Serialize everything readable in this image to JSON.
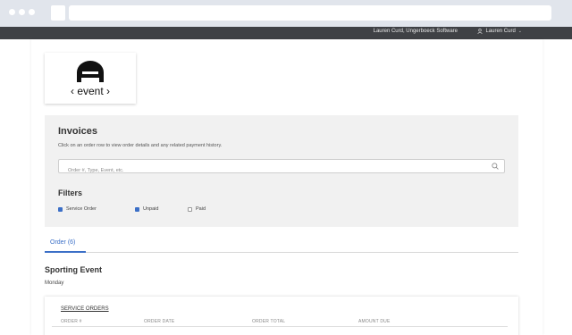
{
  "topnav": {
    "org": "Lauren Curd, Ungerboeck Software",
    "user": "Lauren Curd",
    "user_icon": "user-icon",
    "caret": "⌄"
  },
  "logo": {
    "text": "‹ event ›"
  },
  "invoices": {
    "title": "Invoices",
    "subtitle": "Click on an order row to view order details and any related payment history.",
    "search_placeholder": "Order #, Type, Event, etc.",
    "search_icon": "search-icon"
  },
  "filters": {
    "title": "Filters",
    "items": [
      {
        "label": "Service Order",
        "checked": true
      },
      {
        "label": "Unpaid",
        "checked": true
      },
      {
        "label": "Paid",
        "checked": false
      }
    ]
  },
  "tabs": [
    {
      "label": "Order (6)",
      "active": true
    }
  ],
  "event": {
    "title": "Sporting Event",
    "day": "Monday"
  },
  "orders": {
    "title": "SERVICE ORDERS",
    "columns": [
      "ORDER #",
      "ORDER DATE",
      "ORDER TOTAL",
      "AMOUNT DUE"
    ]
  },
  "colors": {
    "accent": "#3b6fc7",
    "topnav": "#3f4145",
    "panel": "#f1f1f1"
  }
}
